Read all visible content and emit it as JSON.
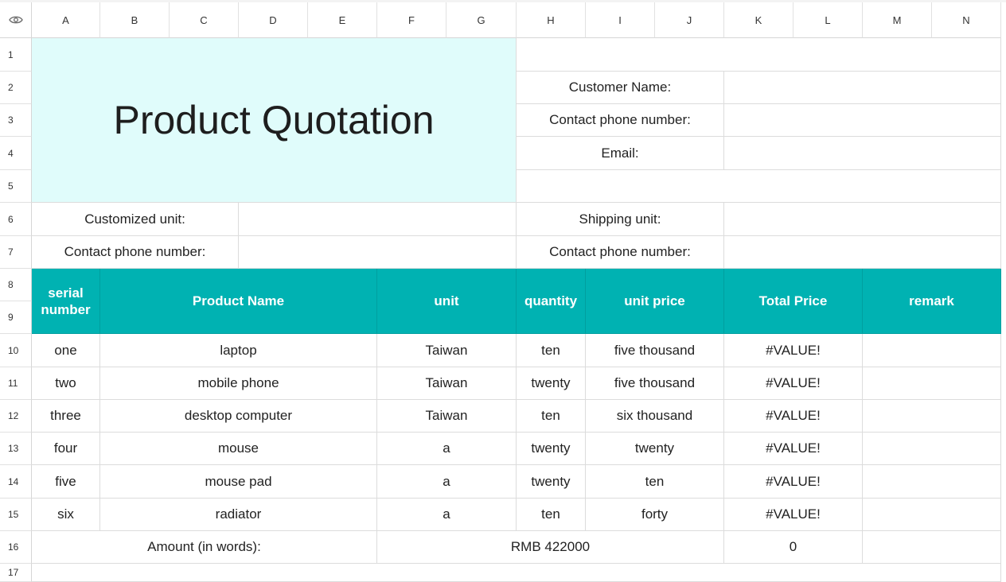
{
  "columns": [
    "A",
    "B",
    "C",
    "D",
    "E",
    "F",
    "G",
    "H",
    "I",
    "J",
    "K",
    "L",
    "M",
    "N"
  ],
  "rows": [
    "1",
    "2",
    "3",
    "4",
    "5",
    "6",
    "7",
    "8",
    "9",
    "10",
    "11",
    "12",
    "13",
    "14",
    "15",
    "16",
    "17"
  ],
  "title": "Product Quotation",
  "customer": {
    "name_label": "Customer Name:",
    "phone_label": "Contact phone number:",
    "email_label": "Email:"
  },
  "parties": {
    "customized_unit_label": "Customized unit:",
    "customized_phone_label": "Contact phone number:",
    "shipping_unit_label": "Shipping unit:",
    "shipping_phone_label": "Contact phone number:"
  },
  "table_headers": {
    "serial": "serial number",
    "product": "Product Name",
    "unit": "unit",
    "quantity": "quantity",
    "unit_price": "unit price",
    "total": "Total Price",
    "remark": "remark"
  },
  "items": [
    {
      "serial": "one",
      "product": "laptop",
      "unit": "Taiwan",
      "quantity": "ten",
      "unit_price": "five thousand",
      "total": "#VALUE!",
      "remark": ""
    },
    {
      "serial": "two",
      "product": "mobile phone",
      "unit": "Taiwan",
      "quantity": "twenty",
      "unit_price": "five thousand",
      "total": "#VALUE!",
      "remark": ""
    },
    {
      "serial": "three",
      "product": "desktop computer",
      "unit": "Taiwan",
      "quantity": "ten",
      "unit_price": "six thousand",
      "total": "#VALUE!",
      "remark": ""
    },
    {
      "serial": "four",
      "product": "mouse",
      "unit": "a",
      "quantity": "twenty",
      "unit_price": "twenty",
      "total": "#VALUE!",
      "remark": ""
    },
    {
      "serial": "five",
      "product": "mouse pad",
      "unit": "a",
      "quantity": "twenty",
      "unit_price": "ten",
      "total": "#VALUE!",
      "remark": ""
    },
    {
      "serial": "six",
      "product": "radiator",
      "unit": "a",
      "quantity": "ten",
      "unit_price": "forty",
      "total": "#VALUE!",
      "remark": ""
    }
  ],
  "summary": {
    "amount_label": "Amount (in words):",
    "amount_value": "RMB 422000",
    "total_value": "0"
  },
  "icons": {
    "corner": "eye-icon"
  }
}
